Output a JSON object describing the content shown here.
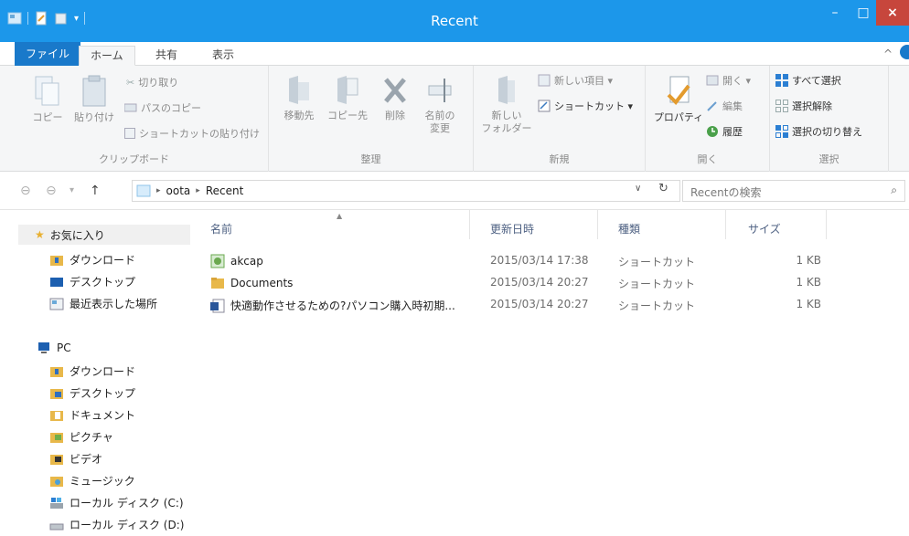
{
  "window": {
    "title": "Recent",
    "minimize": "–",
    "maximize": "□",
    "close": "×"
  },
  "ribbon_tabs": {
    "file": "ファイル",
    "home": "ホーム",
    "share": "共有",
    "view": "表示",
    "collapse": "^"
  },
  "ribbon": {
    "clipboard": {
      "label": "クリップボード",
      "copy": "コピー",
      "paste": "貼り付け",
      "cut": "切り取り",
      "copy_path": "パスのコピー",
      "paste_shortcut": "ショートカットの貼り付け"
    },
    "organize": {
      "label": "整理",
      "move_to": "移動先",
      "copy_to": "コピー先",
      "delete": "削除",
      "rename_1": "名前の",
      "rename_2": "変更"
    },
    "new": {
      "label": "新規",
      "new_folder_1": "新しい",
      "new_folder_2": "フォルダー",
      "new_item": "新しい項目 ▾",
      "shortcut": "ショートカット ▾"
    },
    "open": {
      "label": "開く",
      "properties": "プロパティ",
      "open": "開く ▾",
      "edit": "編集",
      "history": "履歴"
    },
    "select": {
      "label": "選択",
      "select_all": "すべて選択",
      "select_none": "選択解除",
      "invert": "選択の切り替え"
    }
  },
  "address": {
    "back": "⊖",
    "forward": "⊖",
    "dropdown": "▾",
    "up": "↑",
    "crumbs": [
      "oota",
      "Recent"
    ],
    "sep": "▸",
    "dd": "∨",
    "refresh": "↻",
    "search_placeholder": "Recentの検索",
    "search_icon": "⌕"
  },
  "nav": {
    "favorites": "お気に入り",
    "fav_items": [
      "ダウンロード",
      "デスクトップ",
      "最近表示した場所"
    ],
    "pc": "PC",
    "pc_items": [
      "ダウンロード",
      "デスクトップ",
      "ドキュメント",
      "ピクチャ",
      "ビデオ",
      "ミュージック",
      "ローカル ディスク (C:)",
      "ローカル ディスク (D:)"
    ]
  },
  "columns": {
    "name": "名前",
    "date": "更新日時",
    "type": "種類",
    "size": "サイズ",
    "sort": "▲"
  },
  "files": [
    {
      "name": "akcap",
      "date": "2015/03/14 17:38",
      "type": "ショートカット",
      "size": "1 KB",
      "icon": "app-shortcut-icon"
    },
    {
      "name": "Documents",
      "date": "2015/03/14 20:27",
      "type": "ショートカット",
      "size": "1 KB",
      "icon": "folder-icon"
    },
    {
      "name": "快適動作させるための?パソコン購入時初期...",
      "date": "2015/03/14 20:27",
      "type": "ショートカット",
      "size": "1 KB",
      "icon": "word-doc-icon"
    }
  ],
  "colors": {
    "titlebar": "#1c97ea",
    "file_tab": "#1979ca",
    "close": "#c7463c",
    "folder": "#e8b84a"
  }
}
